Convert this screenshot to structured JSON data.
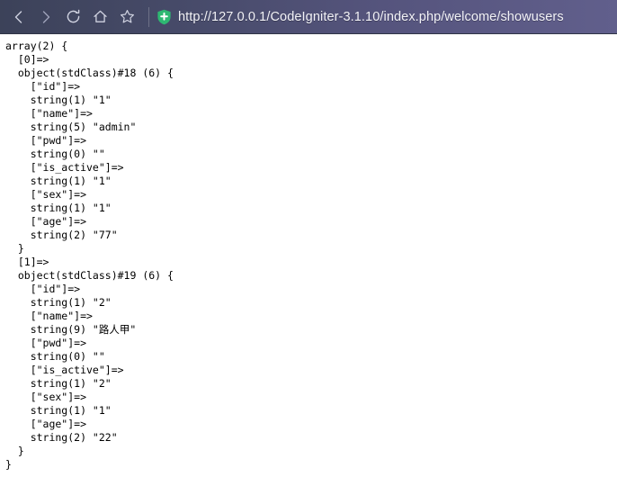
{
  "browser": {
    "nav": {
      "back_label": "Back",
      "forward_label": "Forward",
      "reload_label": "Reload",
      "home_label": "Home",
      "bookmark_label": "Bookmark"
    },
    "security_badge": "shield-plus-icon",
    "url": "http://127.0.0.1/CodeIgniter-3.1.10/index.php/welcome/showusers",
    "toolbar_bg": "#4a4c6e",
    "shield_color": "#2eb872"
  },
  "page": {
    "output": "array(2) {\n  [0]=>\n  object(stdClass)#18 (6) {\n    [\"id\"]=>\n    string(1) \"1\"\n    [\"name\"]=>\n    string(5) \"admin\"\n    [\"pwd\"]=>\n    string(0) \"\"\n    [\"is_active\"]=>\n    string(1) \"1\"\n    [\"sex\"]=>\n    string(1) \"1\"\n    [\"age\"]=>\n    string(2) \"77\"\n  }\n  [1]=>\n  object(stdClass)#19 (6) {\n    [\"id\"]=>\n    string(1) \"2\"\n    [\"name\"]=>\n    string(9) \"路人甲\"\n    [\"pwd\"]=>\n    string(0) \"\"\n    [\"is_active\"]=>\n    string(1) \"2\"\n    [\"sex\"]=>\n    string(1) \"1\"\n    [\"age\"]=>\n    string(2) \"22\"\n  }\n}",
    "dump_type": "array",
    "dump_count": 2,
    "objects": [
      {
        "index": "[0]",
        "class": "stdClass",
        "object_id": "#18",
        "prop_count": 6,
        "props": [
          {
            "key": "id",
            "type": "string",
            "length": 1,
            "value": "1"
          },
          {
            "key": "name",
            "type": "string",
            "length": 5,
            "value": "admin"
          },
          {
            "key": "pwd",
            "type": "string",
            "length": 0,
            "value": ""
          },
          {
            "key": "is_active",
            "type": "string",
            "length": 1,
            "value": "1"
          },
          {
            "key": "sex",
            "type": "string",
            "length": 1,
            "value": "1"
          },
          {
            "key": "age",
            "type": "string",
            "length": 2,
            "value": "77"
          }
        ]
      },
      {
        "index": "[1]",
        "class": "stdClass",
        "object_id": "#19",
        "prop_count": 6,
        "props": [
          {
            "key": "id",
            "type": "string",
            "length": 1,
            "value": "2"
          },
          {
            "key": "name",
            "type": "string",
            "length": 9,
            "value": "路人甲"
          },
          {
            "key": "pwd",
            "type": "string",
            "length": 0,
            "value": ""
          },
          {
            "key": "is_active",
            "type": "string",
            "length": 1,
            "value": "2"
          },
          {
            "key": "sex",
            "type": "string",
            "length": 1,
            "value": "1"
          },
          {
            "key": "age",
            "type": "string",
            "length": 2,
            "value": "22"
          }
        ]
      }
    ]
  }
}
